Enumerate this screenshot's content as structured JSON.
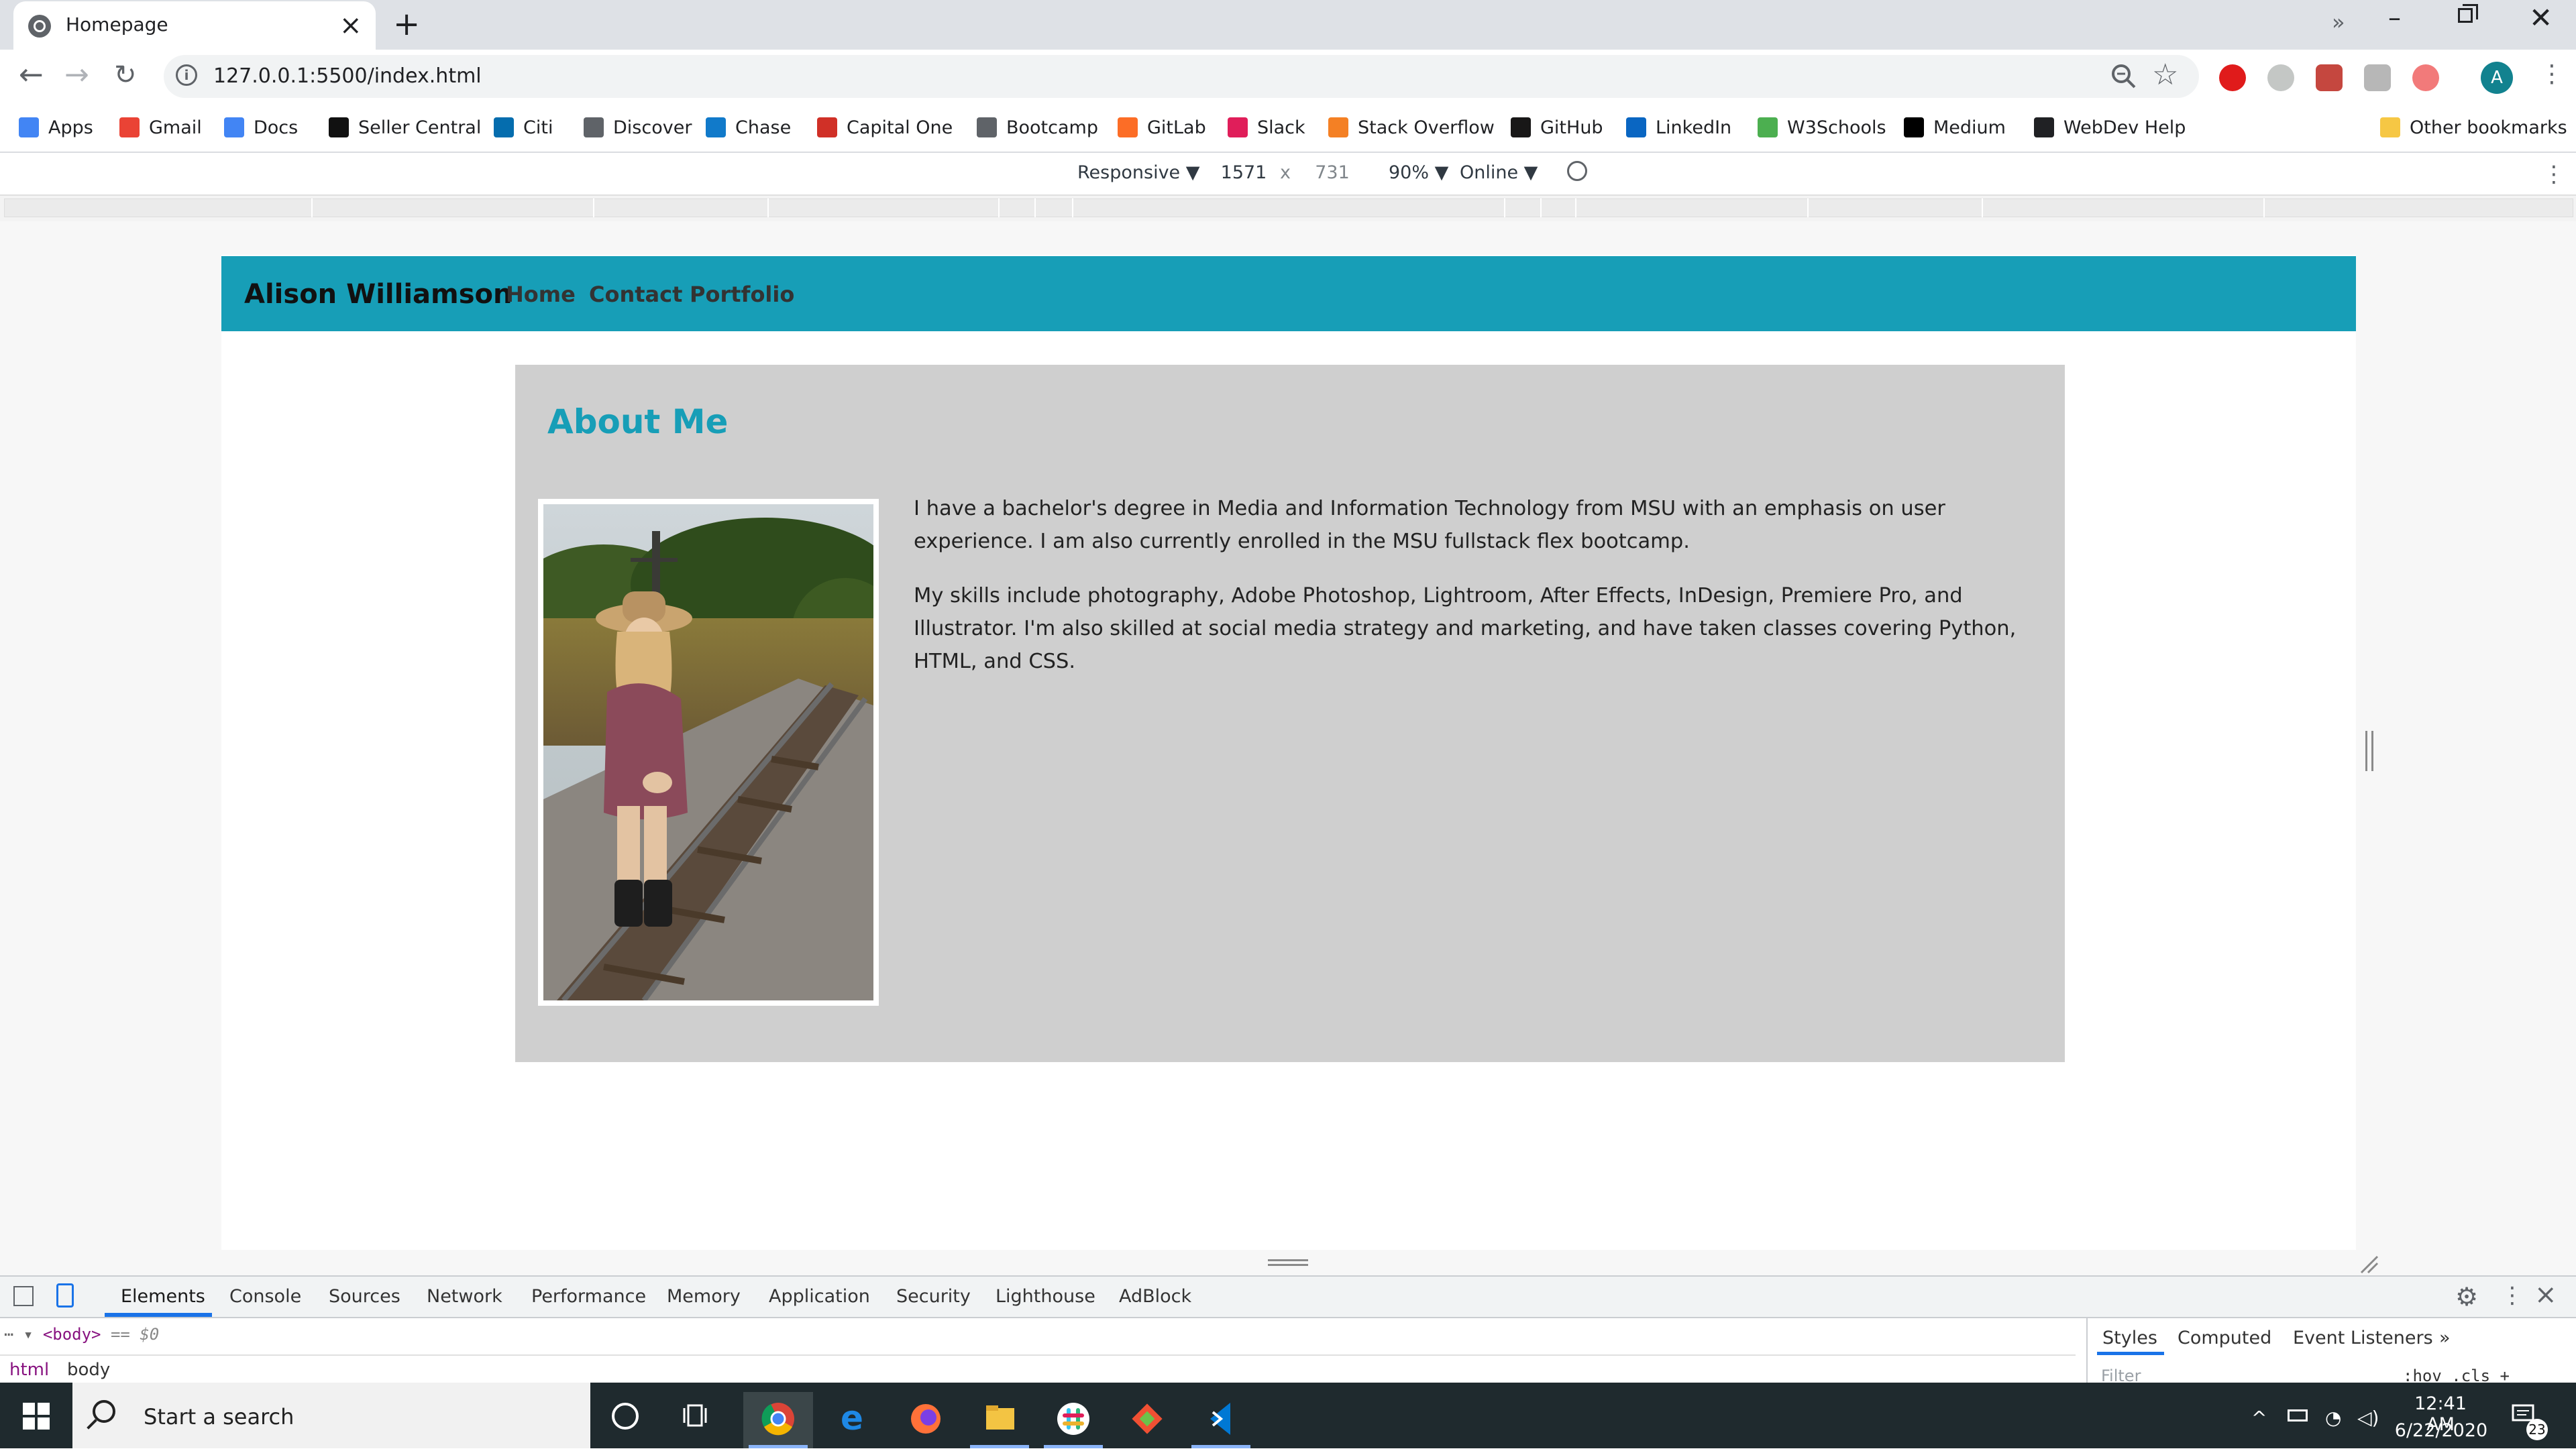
{
  "browser": {
    "tab_title": "Homepage",
    "url": "127.0.0.1:5500/index.html",
    "profile_initial": "A",
    "bookmarks": [
      {
        "label": "Apps",
        "icon": "apps-grid-icon",
        "color": "#4285f4"
      },
      {
        "label": "Gmail",
        "icon": "gmail-icon",
        "color": "#ea4335"
      },
      {
        "label": "Docs",
        "icon": "docs-icon",
        "color": "#4285f4"
      },
      {
        "label": "Seller Central",
        "icon": "amazon-icon",
        "color": "#111111"
      },
      {
        "label": "Citi",
        "icon": "citi-icon",
        "color": "#056dae"
      },
      {
        "label": "Discover",
        "icon": "globe-icon",
        "color": "#5f6368"
      },
      {
        "label": "Chase",
        "icon": "chase-icon",
        "color": "#117aca"
      },
      {
        "label": "Capital One",
        "icon": "capital-one-icon",
        "color": "#d03027"
      },
      {
        "label": "Bootcamp",
        "icon": "globe-icon",
        "color": "#5f6368"
      },
      {
        "label": "GitLab",
        "icon": "gitlab-icon",
        "color": "#fc6d26"
      },
      {
        "label": "Slack",
        "icon": "slack-icon",
        "color": "#e01e5a"
      },
      {
        "label": "Stack Overflow",
        "icon": "stackoverflow-icon",
        "color": "#f48024"
      },
      {
        "label": "GitHub",
        "icon": "github-icon",
        "color": "#181717"
      },
      {
        "label": "LinkedIn",
        "icon": "linkedin-icon",
        "color": "#0a66c2"
      },
      {
        "label": "W3Schools",
        "icon": "w3schools-icon",
        "color": "#4caf50"
      },
      {
        "label": "Medium",
        "icon": "medium-icon",
        "color": "#000000"
      },
      {
        "label": "WebDev Help",
        "icon": "code-icon",
        "color": "#202124"
      }
    ],
    "bookmarks_overflow": "»",
    "other_bookmarks": "Other bookmarks"
  },
  "device_toolbar": {
    "mode": "Responsive ▼",
    "width": "1571",
    "times": "x",
    "height": "731",
    "zoom": "90% ▼",
    "throttle": "Online ▼"
  },
  "site": {
    "brand": "Alison Williamson",
    "nav_color": "#179eb7",
    "nav_links": [
      "Home",
      "Contact",
      "Portfolio"
    ],
    "about_title": "About Me",
    "paragraphs": [
      "I have a bachelor's degree in Media and Information Technology from MSU with an emphasis on user experience. I am also currently enrolled in the MSU fullstack flex bootcamp.",
      "My skills include photography, Adobe Photoshop, Lightroom, After Effects, InDesign, Premiere Pro, and Illustrator. I'm also skilled at social media strategy and marketing, and have taken classes covering Python, HTML, and CSS."
    ]
  },
  "devtools": {
    "tabs": [
      "Elements",
      "Console",
      "Sources",
      "Network",
      "Performance",
      "Memory",
      "Application",
      "Security",
      "Lighthouse",
      "AdBlock"
    ],
    "active_tab": "Elements",
    "dom_line": "<body>",
    "dom_ref": "== $0",
    "breadcrumbs": [
      "html",
      "body"
    ],
    "styles_tabs": [
      "Styles",
      "Computed",
      "Event Listeners"
    ],
    "styles_more": "»",
    "filter_placeholder": "Filter",
    "hov_cls": ":hov  .cls  +"
  },
  "taskbar": {
    "search_placeholder": "Start a search",
    "time": "12:41 AM",
    "date": "6/22/2020",
    "notification_count": "23",
    "apps": [
      "chrome-icon",
      "edge-icon",
      "firefox-icon",
      "file-explorer-icon",
      "slack-icon",
      "git-icon",
      "vscode-icon"
    ]
  }
}
